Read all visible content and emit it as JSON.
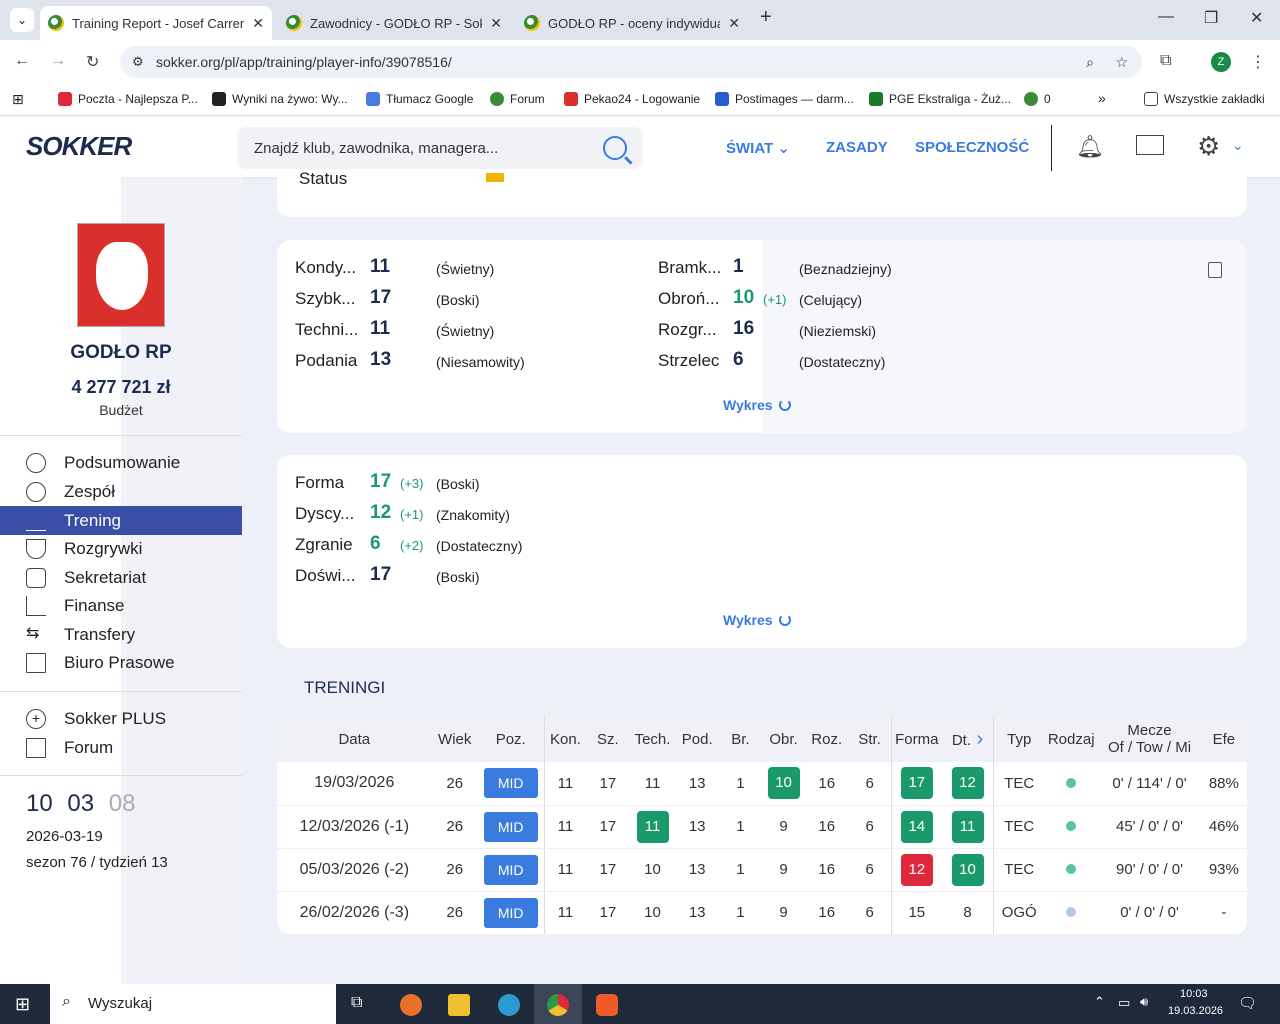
{
  "browser": {
    "tabs": [
      {
        "title": "Training Report - Josef Carren -"
      },
      {
        "title": "Zawodnicy - GODŁO RP - Sokker"
      },
      {
        "title": "GODŁO RP - oceny indywidualne"
      }
    ],
    "url": "sokker.org/pl/app/training/player-info/39078516/",
    "bookmarks": [
      "Poczta - Najlepsza P...",
      "Wyniki na żywo: Wy...",
      "Tłumacz Google",
      "Forum",
      "Pekao24 - Logowanie",
      "Postimages — darm...",
      "PGE Ekstraliga - Żuż...",
      "0"
    ],
    "all_bookmarks": "Wszystkie zakładki",
    "profile_initial": "Z"
  },
  "site": {
    "logo": "SOKKER",
    "search_placeholder": "Znajdź klub, zawodnika, managera...",
    "nav": [
      "ŚWIAT",
      "ZASADY",
      "SPOŁECZNOŚĆ"
    ]
  },
  "sidebar": {
    "club_name": "GODŁO RP",
    "budget": "4 277 721 zł",
    "budget_label": "Budżet",
    "menu": [
      {
        "label": "Podsumowanie",
        "icon": "medal-icon"
      },
      {
        "label": "Zespół",
        "icon": "ball-icon"
      },
      {
        "label": "Trening",
        "icon": "cone-icon",
        "active": true
      },
      {
        "label": "Rozgrywki",
        "icon": "trophy-icon"
      },
      {
        "label": "Sekretariat",
        "icon": "briefcase-icon"
      },
      {
        "label": "Finanse",
        "icon": "chart-icon"
      },
      {
        "label": "Transfery",
        "icon": "transfer-icon"
      },
      {
        "label": "Biuro Prasowe",
        "icon": "newspaper-icon"
      }
    ],
    "extra": [
      {
        "label": "Sokker PLUS",
        "icon": "plus-circle-icon"
      },
      {
        "label": "Forum",
        "icon": "chat-icon"
      }
    ],
    "clock": {
      "h": "10",
      "m": "03",
      "s": "08"
    },
    "date": "2026-03-19",
    "season": "sezon 76 / tydzień 13"
  },
  "status_label": "Status",
  "skills_left": [
    {
      "name": "Kondy...",
      "value": "11",
      "delta": "",
      "desc": "(Świetny)"
    },
    {
      "name": "Szybk...",
      "value": "17",
      "delta": "",
      "desc": "(Boski)"
    },
    {
      "name": "Techni...",
      "value": "11",
      "delta": "",
      "desc": "(Świetny)"
    },
    {
      "name": "Podania",
      "value": "13",
      "delta": "",
      "desc": "(Niesamowity)"
    }
  ],
  "skills_right": [
    {
      "name": "Bramk...",
      "value": "1",
      "delta": "",
      "desc": "(Beznadziejny)"
    },
    {
      "name": "Obroń...",
      "value": "10",
      "delta": "(+1)",
      "desc": "(Celujący)"
    },
    {
      "name": "Rozgr...",
      "value": "16",
      "delta": "",
      "desc": "(Nieziemski)"
    },
    {
      "name": "Strzelec",
      "value": "6",
      "delta": "",
      "desc": "(Dostateczny)"
    }
  ],
  "form": [
    {
      "name": "Forma",
      "value": "17",
      "delta": "(+3)",
      "desc": "(Boski)"
    },
    {
      "name": "Dyscy...",
      "value": "12",
      "delta": "(+1)",
      "desc": "(Znakomity)"
    },
    {
      "name": "Zgranie",
      "value": "6",
      "delta": "(+2)",
      "desc": "(Dostateczny)"
    },
    {
      "name": "Doświ...",
      "value": "17",
      "delta": "",
      "desc": "(Boski)"
    }
  ],
  "wykres": "Wykres",
  "trainings_title": "TRENINGI",
  "table": {
    "headers": [
      "Data",
      "Wiek",
      "Poz.",
      "Kon.",
      "Sz.",
      "Tech.",
      "Pod.",
      "Br.",
      "Obr.",
      "Roz.",
      "Str.",
      "Forma",
      "Dt.",
      "Typ",
      "Rodzaj",
      "Mecze\nOf / Tow / Mi",
      "Efe"
    ],
    "rows": [
      {
        "date": "19/03/2026",
        "age": "26",
        "pos": "MID",
        "kon": "11",
        "sz": "17",
        "tech": "11",
        "pod": "13",
        "br": "1",
        "obr": "10",
        "roz": "16",
        "str": "6",
        "forma": "17",
        "dt": "12",
        "typ": "TEC",
        "mecze": "0' / 114' / 0'",
        "efe": "88%",
        "hl": {
          "obr": "g",
          "forma": "g",
          "dt": "g"
        },
        "dot": "g"
      },
      {
        "date": "12/03/2026 (-1)",
        "age": "26",
        "pos": "MID",
        "kon": "11",
        "sz": "17",
        "tech": "11",
        "pod": "13",
        "br": "1",
        "obr": "9",
        "roz": "16",
        "str": "6",
        "forma": "14",
        "dt": "11",
        "typ": "TEC",
        "mecze": "45' / 0' / 0'",
        "efe": "46%",
        "hl": {
          "tech": "g",
          "forma": "g",
          "dt": "g"
        },
        "dot": "g"
      },
      {
        "date": "05/03/2026 (-2)",
        "age": "26",
        "pos": "MID",
        "kon": "11",
        "sz": "17",
        "tech": "10",
        "pod": "13",
        "br": "1",
        "obr": "9",
        "roz": "16",
        "str": "6",
        "forma": "12",
        "dt": "10",
        "typ": "TEC",
        "mecze": "90' / 0' / 0'",
        "efe": "93%",
        "hl": {
          "forma": "r",
          "dt": "g"
        },
        "dot": "g"
      },
      {
        "date": "26/02/2026 (-3)",
        "age": "26",
        "pos": "MID",
        "kon": "11",
        "sz": "17",
        "tech": "10",
        "pod": "13",
        "br": "1",
        "obr": "9",
        "roz": "16",
        "str": "6",
        "forma": "15",
        "dt": "8",
        "typ": "OGÓ",
        "mecze": "0' / 0' / 0'",
        "efe": "-",
        "hl": {},
        "dot": "b"
      }
    ]
  },
  "taskbar": {
    "search": "Wyszukaj",
    "time": "10:03",
    "date": "19.03.2026"
  }
}
